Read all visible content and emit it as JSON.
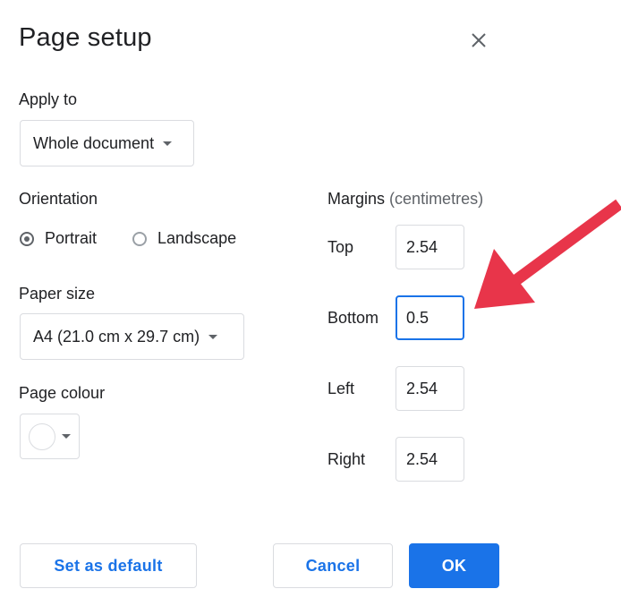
{
  "dialog": {
    "title": "Page setup",
    "close_icon": "close-icon"
  },
  "apply_to": {
    "label": "Apply to",
    "selected": "Whole document"
  },
  "orientation": {
    "label": "Orientation",
    "options": [
      {
        "label": "Portrait",
        "checked": true
      },
      {
        "label": "Landscape",
        "checked": false
      }
    ]
  },
  "paper_size": {
    "label": "Paper size",
    "selected": "A4 (21.0 cm x 29.7 cm)"
  },
  "page_colour": {
    "label": "Page colour",
    "value": "#ffffff"
  },
  "margins": {
    "label": "Margins",
    "unit": "(centimetres)",
    "rows": [
      {
        "label": "Top",
        "value": "2.54"
      },
      {
        "label": "Bottom",
        "value": "0.5",
        "focused": true
      },
      {
        "label": "Left",
        "value": "2.54"
      },
      {
        "label": "Right",
        "value": "2.54"
      }
    ]
  },
  "buttons": {
    "set_default": "Set as default",
    "cancel": "Cancel",
    "ok": "OK"
  },
  "colors": {
    "accent": "#1a73e8",
    "annotation_arrow": "#e8354a"
  }
}
